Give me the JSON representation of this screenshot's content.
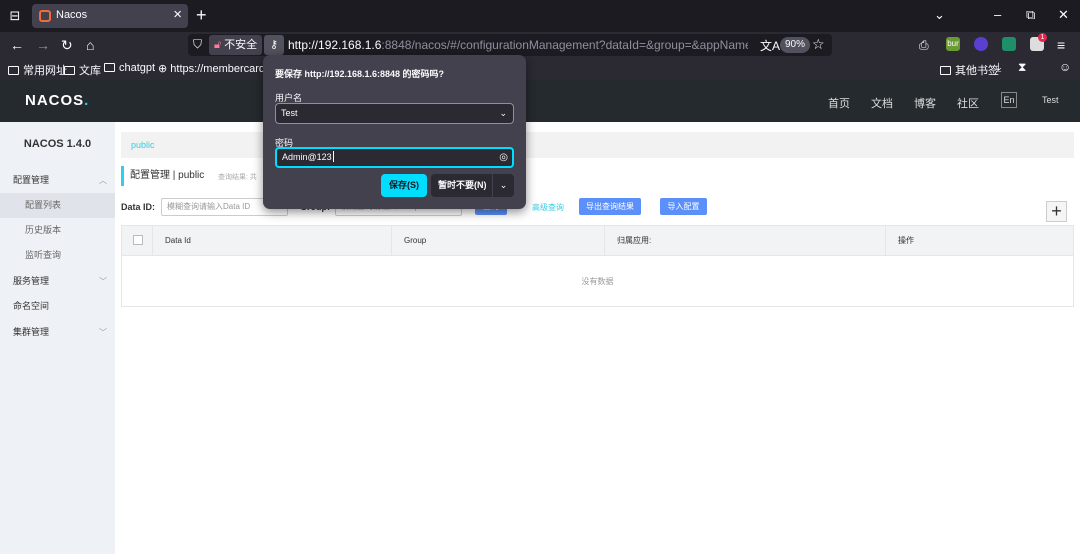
{
  "browser": {
    "tab_title": "Nacos",
    "tab_close": "×",
    "new_tab": "+",
    "insecure_label": "不安全",
    "url_host": "http://192.168.1.6",
    "url_rest": ":8848/nacos/#/configurationManagement?dataId=&group=&appName=&namesp",
    "zoom": "90%",
    "bookmarks": [
      "常用网址",
      "文库",
      "chatgpt",
      "https://membercard..."
    ],
    "other_bookmarks": "其他书签",
    "ext_badge": "1",
    "ext_bur": "bur"
  },
  "popup": {
    "title": "要保存 http://192.168.1.6:8848 的密码吗?",
    "username_label": "用户名",
    "username_value": "Test",
    "password_label": "密码",
    "password_value": "Admin@123",
    "save_button": "保存(S)",
    "dont_save_button": "暂时不要(N)"
  },
  "header": {
    "logo": "NACOS",
    "logo_dot": ".",
    "nav": [
      "首页",
      "文档",
      "博客",
      "社区"
    ],
    "lang": "En",
    "user": "Test"
  },
  "sidebar": {
    "version": "NACOS 1.4.0",
    "items": [
      {
        "label": "配置管理"
      },
      {
        "label": "配置列表"
      },
      {
        "label": "历史版本"
      },
      {
        "label": "监听查询"
      },
      {
        "label": "服务管理"
      },
      {
        "label": "命名空间"
      },
      {
        "label": "集群管理"
      }
    ]
  },
  "main": {
    "namespace_tab": "public",
    "page_title": "配置管理 | public",
    "query_result_hint": "查询结果: 共",
    "data_id_label": "Data ID:",
    "data_id_placeholder": "模糊查询请输入Data ID",
    "group_label": "Group:",
    "group_placeholder": "模糊查询请输入Group",
    "query_button": "查询",
    "advanced_query": "高级查询",
    "export_button": "导出查询结果",
    "import_button": "导入配置",
    "add_button": "+",
    "table": {
      "columns": [
        "Data Id",
        "Group",
        "归属应用:",
        "操作"
      ],
      "empty_text": "没有数据"
    }
  }
}
